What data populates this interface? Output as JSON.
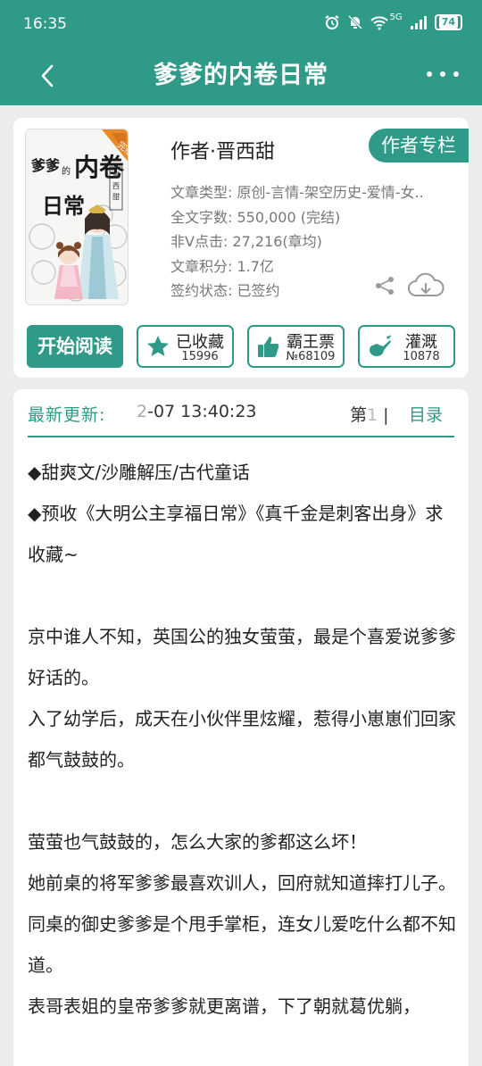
{
  "status": {
    "time": "16:35",
    "network": "5G",
    "battery": "74"
  },
  "nav": {
    "title": "爹爹的内卷日常"
  },
  "book": {
    "cover": {
      "badge": "完结",
      "title_text": "爹爹的内卷日常",
      "author_text": "晋西甜"
    },
    "author_line": "作者·晋西甜",
    "author_column": "作者专栏",
    "info": [
      "文章类型: 原创-言情-架空历史-爱情-女..",
      "全文字数: 550,000 (完结)",
      "非Ⅴ点击: 27,216(章均)",
      "文章积分: 1.7亿",
      "签约状态: 已签约"
    ],
    "start_reading": "开始阅读",
    "stats": [
      {
        "label": "已收藏",
        "count": "15996",
        "icon": "star-icon"
      },
      {
        "label": "霸王票",
        "count": "№68109",
        "icon": "thumbs-up-icon"
      },
      {
        "label": "灌溉",
        "count": "10878",
        "icon": "watering-can-icon"
      }
    ]
  },
  "update": {
    "label": "最新更新:",
    "time_faded": "2",
    "time": "-07 13:40:23",
    "chapter_prefix": "第",
    "chapter_faded": "1",
    "chapter_suffix": "|",
    "toc": "目录"
  },
  "intro": [
    "◆甜爽文/沙雕解压/古代童话",
    "◆预收《大明公主享福日常》《真千金是刺客出身》求收藏~",
    "",
    "京中谁人不知，英国公的独女萤萤，最是个喜爱说爹爹好话的。",
    "入了幼学后，成天在小伙伴里炫耀，惹得小崽崽们回家都气鼓鼓的。",
    "",
    "萤萤也气鼓鼓的，怎么大家的爹都这么坏！",
    "她前桌的将军爹爹最喜欢训人，回府就知道摔打儿子。",
    "同桌的御史爹爹是个甩手掌柜，连女儿爱吃什么都不知道。",
    "表哥表姐的皇帝爹爹就更离谱，下了朝就葛优躺，"
  ],
  "colors": {
    "accent": "#2f9a88"
  }
}
